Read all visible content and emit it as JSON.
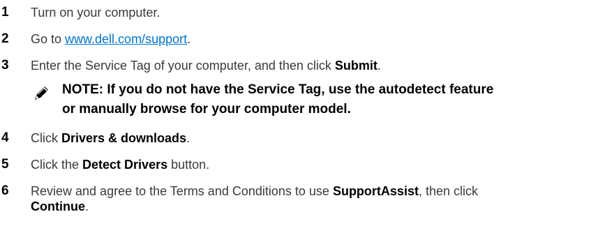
{
  "steps": [
    {
      "num": "1",
      "text": "Turn on your computer."
    },
    {
      "num": "2",
      "prefix": "Go to ",
      "link": "www.dell.com/support",
      "suffix": "."
    },
    {
      "num": "3",
      "prefix": "Enter the Service Tag of your computer, and then click ",
      "bold": "Submit",
      "suffix": "."
    },
    {
      "num": "4",
      "prefix": "Click ",
      "bold": "Drivers & downloads",
      "suffix": "."
    },
    {
      "num": "5",
      "prefix": "Click the ",
      "bold": "Detect Drivers",
      "suffix": " button."
    },
    {
      "num": "6",
      "prefix": "Review and agree to the Terms and Conditions to use ",
      "bold": "SupportAssist",
      "middle": ", then click",
      "bold2": "Continue",
      "suffix": "."
    }
  ],
  "note": {
    "icon": "note-pencil-icon",
    "line1": "NOTE: If you do not have the Service Tag, use the autodetect feature",
    "line2": "or manually browse for your computer model."
  },
  "colors": {
    "link": "#0076ce",
    "text": "#3a3a3a",
    "strong": "#000000"
  }
}
